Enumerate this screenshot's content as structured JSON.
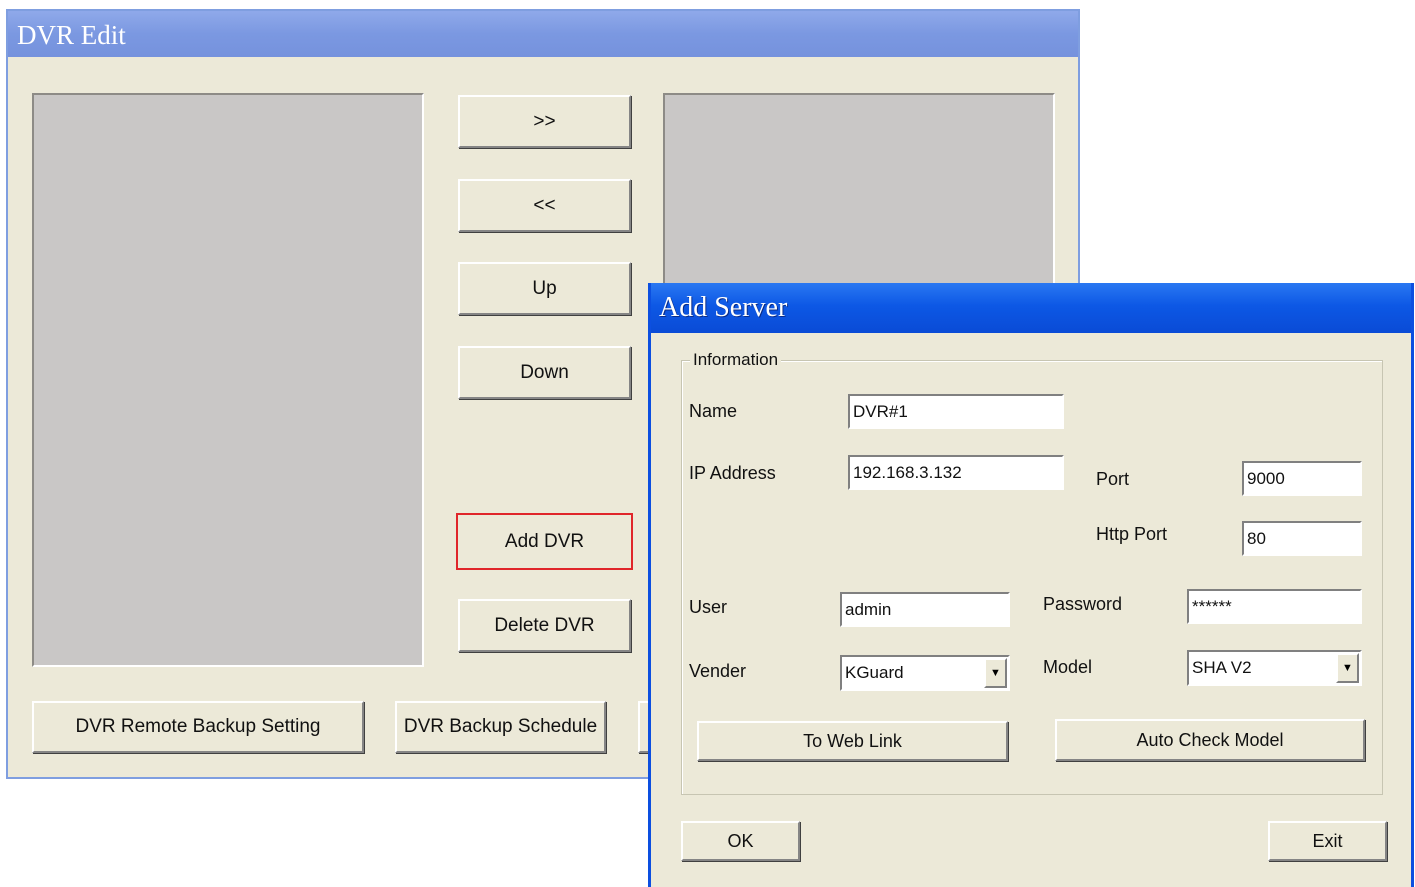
{
  "dvr_edit": {
    "title": "DVR Edit",
    "buttons": {
      "move_right": ">>",
      "move_left": "<<",
      "up": "Up",
      "down": "Down",
      "add_dvr": "Add DVR",
      "delete_dvr": "Delete DVR",
      "remote_backup_setting": "DVR Remote Backup Setting",
      "backup_schedule": "DVR Backup Schedule"
    },
    "highlight_color": "#e0262a"
  },
  "add_server": {
    "title": "Add Server",
    "group_label": "Information",
    "labels": {
      "name": "Name",
      "ip_address": "IP Address",
      "port": "Port",
      "http_port": "Http Port",
      "user": "User",
      "password": "Password",
      "vender": "Vender",
      "model": "Model"
    },
    "values": {
      "name": "DVR#1",
      "ip_address": "192.168.3.132",
      "port": "9000",
      "http_port": "80",
      "user": "admin",
      "password": "******",
      "vender": "KGuard",
      "model": "SHA V2"
    },
    "buttons": {
      "to_web_link": "To Web Link",
      "auto_check_model": "Auto Check Model",
      "ok": "OK",
      "exit": "Exit"
    },
    "icons": {
      "dropdown": "chevron-down-icon"
    },
    "title_color": "#0d58e5"
  }
}
